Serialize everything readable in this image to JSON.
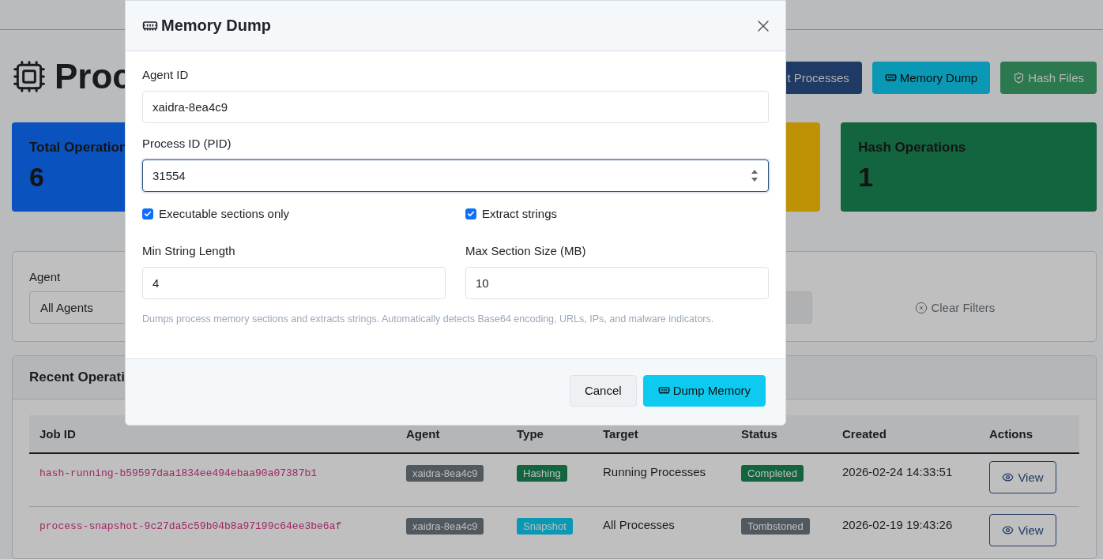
{
  "page": {
    "title": "Proc",
    "actions": [
      {
        "kind": "processes",
        "label": "t Processes"
      },
      {
        "kind": "memory",
        "label": "Memory Dump"
      },
      {
        "kind": "hash",
        "label": "Hash Files"
      }
    ]
  },
  "stats": [
    {
      "label": "Total Operation",
      "value": "6",
      "color": "#0a53be"
    },
    {
      "color": "#bf9105"
    },
    {
      "label": "Hash Operations",
      "value": "1",
      "color": "#13653f"
    }
  ],
  "filters": [
    {
      "kind": "select",
      "label": "Agent",
      "value": "All Agents"
    },
    {
      "kind": "disabled"
    }
  ],
  "clear_filters": "Clear Filters",
  "operations": {
    "title": "Recent Operati",
    "columns": [
      "Job ID",
      "Agent",
      "Type",
      "Target",
      "Status",
      "Created",
      "Actions"
    ],
    "rows": [
      {
        "job_id": "hash-running-b59597daa1834ee494ebaa90a07387b1",
        "agent": "xaidra-8ea4c9",
        "type": {
          "label": "Hashing",
          "color": "#13653f"
        },
        "target": "Running Processes",
        "status": {
          "label": "Completed",
          "color": "#13653f"
        },
        "created": "2026-02-24 14:33:51",
        "action": "View"
      },
      {
        "job_id": "process-snapshot-9c27da5c59b04b8a97199c64ee3be6af",
        "agent": "xaidra-8ea4c9",
        "type": {
          "label": "Snapshot",
          "color": "#0a98b4"
        },
        "target": "All Processes",
        "status": {
          "label": "Tombstoned",
          "color": "#51585e"
        },
        "created": "2026-02-19 19:43:26",
        "action": "View"
      }
    ]
  },
  "modal": {
    "title": "Memory Dump",
    "agent_id": {
      "label": "Agent ID",
      "value": "xaidra-8ea4c9"
    },
    "pid": {
      "label": "Process ID (PID)",
      "value": "31554"
    },
    "checkboxes": [
      {
        "label": "Executable sections only",
        "checked": true
      },
      {
        "label": "Extract strings",
        "checked": true
      }
    ],
    "numbers": [
      {
        "label": "Min String Length",
        "value": "4"
      },
      {
        "label": "Max Section Size (MB)",
        "value": "10"
      }
    ],
    "help": "Dumps process memory sections and extracts strings. Automatically detects Base64 encoding, URLs, IPs, and malware indicators.",
    "buttons": [
      {
        "kind": "cancel",
        "label": "Cancel"
      },
      {
        "kind": "submit",
        "label": "Dump Memory"
      }
    ]
  }
}
